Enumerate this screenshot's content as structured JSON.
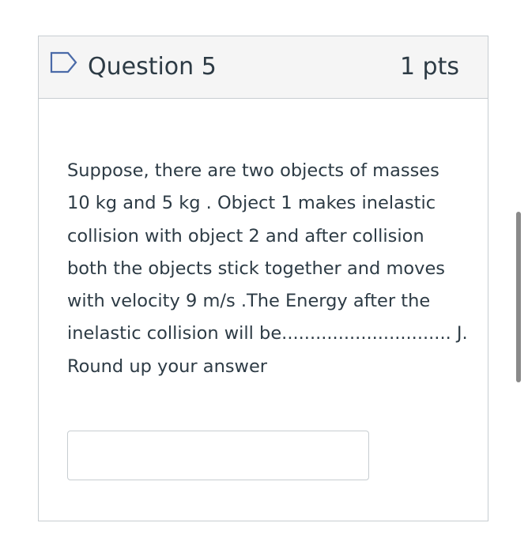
{
  "question": {
    "title": "Question 5",
    "points": "1 pts",
    "flag_icon": "flag-outline-icon",
    "text_lines": [
      "Suppose, there are two objects of masses",
      "10 kg and 5 kg . Object 1 makes inelastic",
      "collision with object 2 and after collision",
      "both the objects stick together and moves",
      "with velocity 9 m/s .The Energy after the",
      "inelastic collision will be.............................. J.",
      "Round up your answer"
    ],
    "answer_value": ""
  },
  "colors": {
    "header_bg": "#f5f5f5",
    "border": "#c7cdd1",
    "text": "#2d3b45",
    "flag_stroke": "#4a6aa8",
    "scrollbar": "#8a8a8a"
  }
}
